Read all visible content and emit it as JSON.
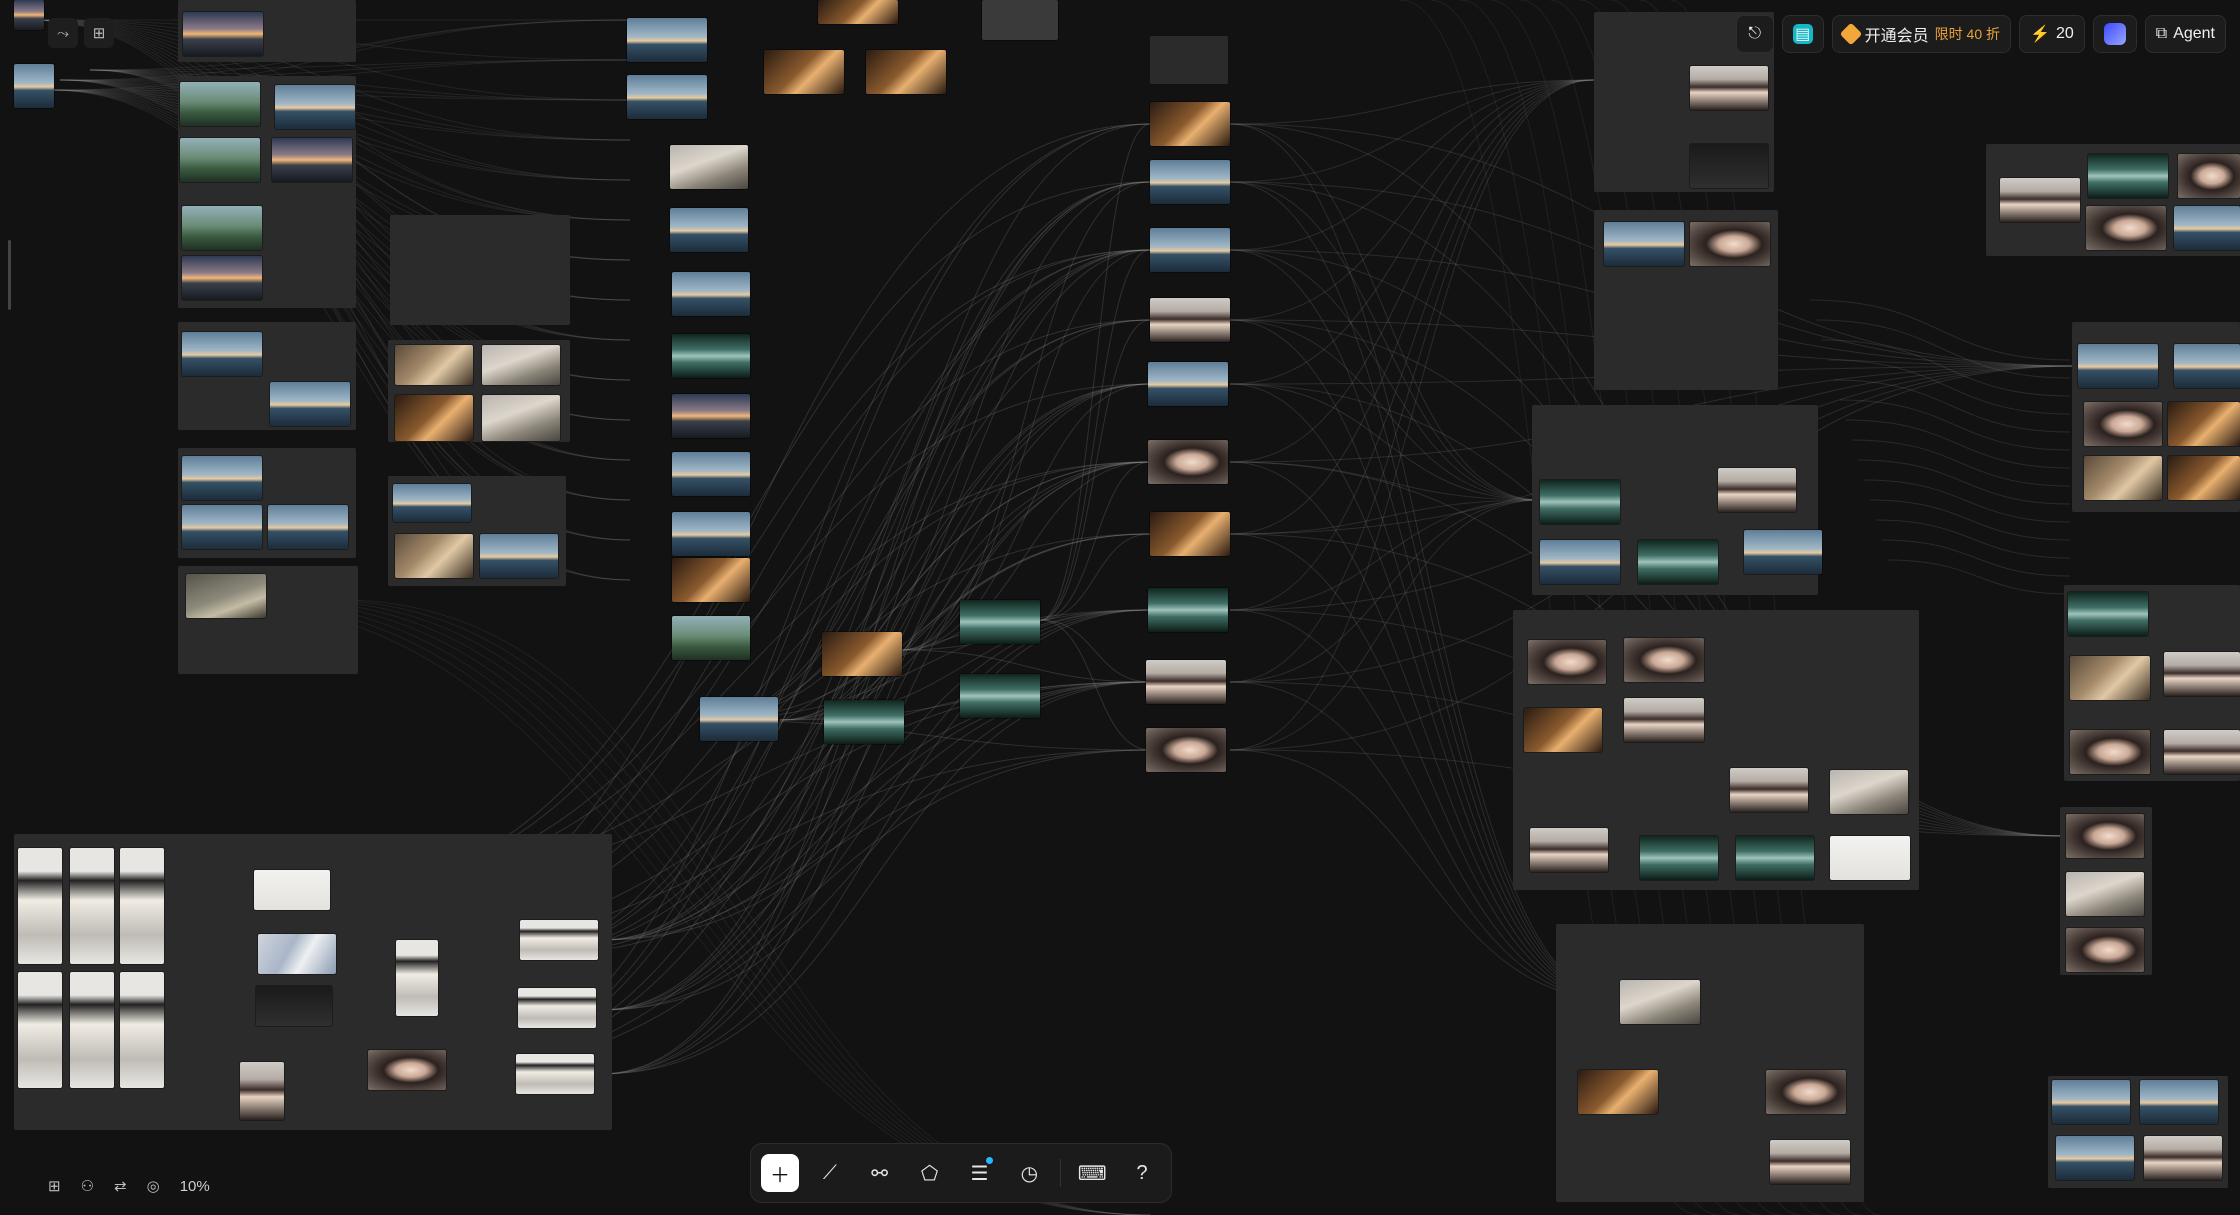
{
  "header": {
    "share_icon": "share-icon",
    "layers_icon": "layers-icon",
    "membership_label": "开通会员",
    "membership_badge": "限时 40 折",
    "credits": "20",
    "agent_label": "Agent"
  },
  "status_bar": {
    "zoom": "10%",
    "icons": [
      "grid-icon",
      "person-icon",
      "swap-icon",
      "fingerprint-icon"
    ]
  },
  "dock": {
    "tools": [
      {
        "name": "add",
        "icon": "plus-icon",
        "active": true
      },
      {
        "name": "select",
        "icon": "cursor-icon",
        "active": false
      },
      {
        "name": "connect",
        "icon": "nodes-icon",
        "active": false
      },
      {
        "name": "shapes",
        "icon": "shapes-icon",
        "active": false
      },
      {
        "name": "assets",
        "icon": "stack-icon",
        "active": false,
        "notify": true
      },
      {
        "name": "history",
        "icon": "clock-icon",
        "active": false
      },
      {
        "name": "keyboard",
        "icon": "keyboard-icon",
        "active": false
      },
      {
        "name": "help",
        "icon": "help-icon",
        "active": false
      }
    ]
  },
  "canvas": {
    "node_kinds": [
      "sea",
      "dusk",
      "green",
      "room",
      "warm",
      "bed",
      "train",
      "portrait",
      "face",
      "white",
      "dark",
      "figure",
      "cloth",
      "rain",
      "blank"
    ]
  },
  "colors": {
    "background": "#121212",
    "group": "#2b2b2b",
    "wire": "#8a8a8a",
    "accent": "#13b8c8",
    "badge": "#e9a23b"
  }
}
